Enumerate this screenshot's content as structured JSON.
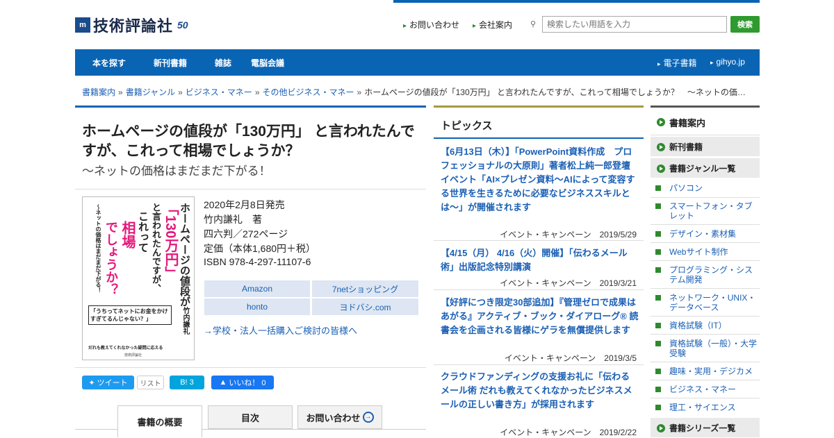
{
  "header": {
    "logo_mark": "m",
    "logo_text": "技術評論社",
    "logo_anniversary": "50",
    "links": [
      "お問い合わせ",
      "会社案内"
    ],
    "search_placeholder": "検索したい用語を入力",
    "search_button": "検索",
    "search_icon": "search-icon"
  },
  "nav": {
    "items": [
      "本を探す",
      "新刊書籍",
      "雑誌",
      "電脳会議"
    ],
    "right": [
      "電子書籍",
      "gihyo.jp"
    ]
  },
  "breadcrumb": {
    "links": [
      "書籍案内",
      "書籍ジャンル",
      "ビジネス・マネー",
      "その他ビジネス・マネー"
    ],
    "separator": "»",
    "current": "ホームページの値段が「130万円」 と言われたんですが、これって相場でしょうか？　～ネットの価…"
  },
  "book": {
    "title": "ホームページの値段が「130万円」 と言われたんですが、これって相場でしょうか？",
    "subtitle": "～ネットの価格はまだまだ下がる！",
    "release": "2020年2月8日発売",
    "author": "竹内謙礼　著",
    "format": "四六判／272ページ",
    "price": "定価（本体1,680円＋税）",
    "isbn": "ISBN 978-4-297-11107-6",
    "shops": [
      "Amazon",
      "7netショッピング",
      "honto",
      "ヨドバシ.com"
    ],
    "bulk_link": "→学校・法人一括購入ご検討の皆様へ",
    "cover": {
      "col1": "ホームページの値段が",
      "col2": "「130万円」",
      "col3": "と言われたんですが、",
      "col4": "これって",
      "col5": "相場",
      "col6": "でしょうか？",
      "col7": "～ネットの価格はまだまだ下がる！",
      "author": "竹内謙礼",
      "callout": "「うちってネットにお金をかけすぎてるんじゃない？」",
      "blurb": "だれも教えてくれなかった疑問に応える",
      "publisher": "技術評論社",
      "accent": "#e4187a"
    }
  },
  "social": {
    "tweet": "ツイート",
    "list": "リスト",
    "hatena": "B! 3",
    "like": "いいね！ 0"
  },
  "tabs": [
    "書籍の概要",
    "目次",
    "お問い合わせ"
  ],
  "topics": {
    "heading": "トピックス",
    "items": [
      {
        "title": "【6月13日（木）】「PowerPoint資料作成　プロフェッショナルの大原則」著者松上純一郎登壇イベント「AI×プレゼン資料～AIによって変容する世界を生きるために必要なビジネススキルとは～」が開催されます",
        "category": "イベント・キャンペーン",
        "date": "2019/5/29"
      },
      {
        "title": "【4/15（月） 4/16（火）開催】「伝わるメール術」出版記念特別講演",
        "category": "イベント・キャンペーン",
        "date": "2019/3/21"
      },
      {
        "title": "【好評につき限定30部追加】『管理ゼロで成果はあがる』アクティブ・ブック・ダイアローグ® 読書会を企画される皆様にゲラを無償提供します",
        "category": "イベント・キャンペーン",
        "date": "2019/3/5"
      },
      {
        "title": "クラウドファンディングの支援お礼に「伝わるメール術 だれも教えてくれなかったビジネスメールの正しい書き方」が採用されます",
        "category": "イベント・キャンペーン",
        "date": "2019/2/22"
      }
    ]
  },
  "sidebar": {
    "heading": "書籍案内",
    "new_books": "新刊書籍",
    "genre_heading": "書籍ジャンル一覧",
    "genres": [
      "パソコン",
      "スマートフォン・タブレット",
      "デザイン・素材集",
      "Webサイト制作",
      "プログラミング・システム開発",
      "ネットワーク・UNIX・データベース",
      "資格試験（IT）",
      "資格試験（一般）・大学受験",
      "趣味・実用・デジカメ",
      "ビジネス・マネー",
      "理工・サイエンス"
    ],
    "series_heading": "書籍シリーズ一覧"
  },
  "colors": {
    "brand_blue": "#0a64b4",
    "accent_green": "#2f9a2f"
  }
}
